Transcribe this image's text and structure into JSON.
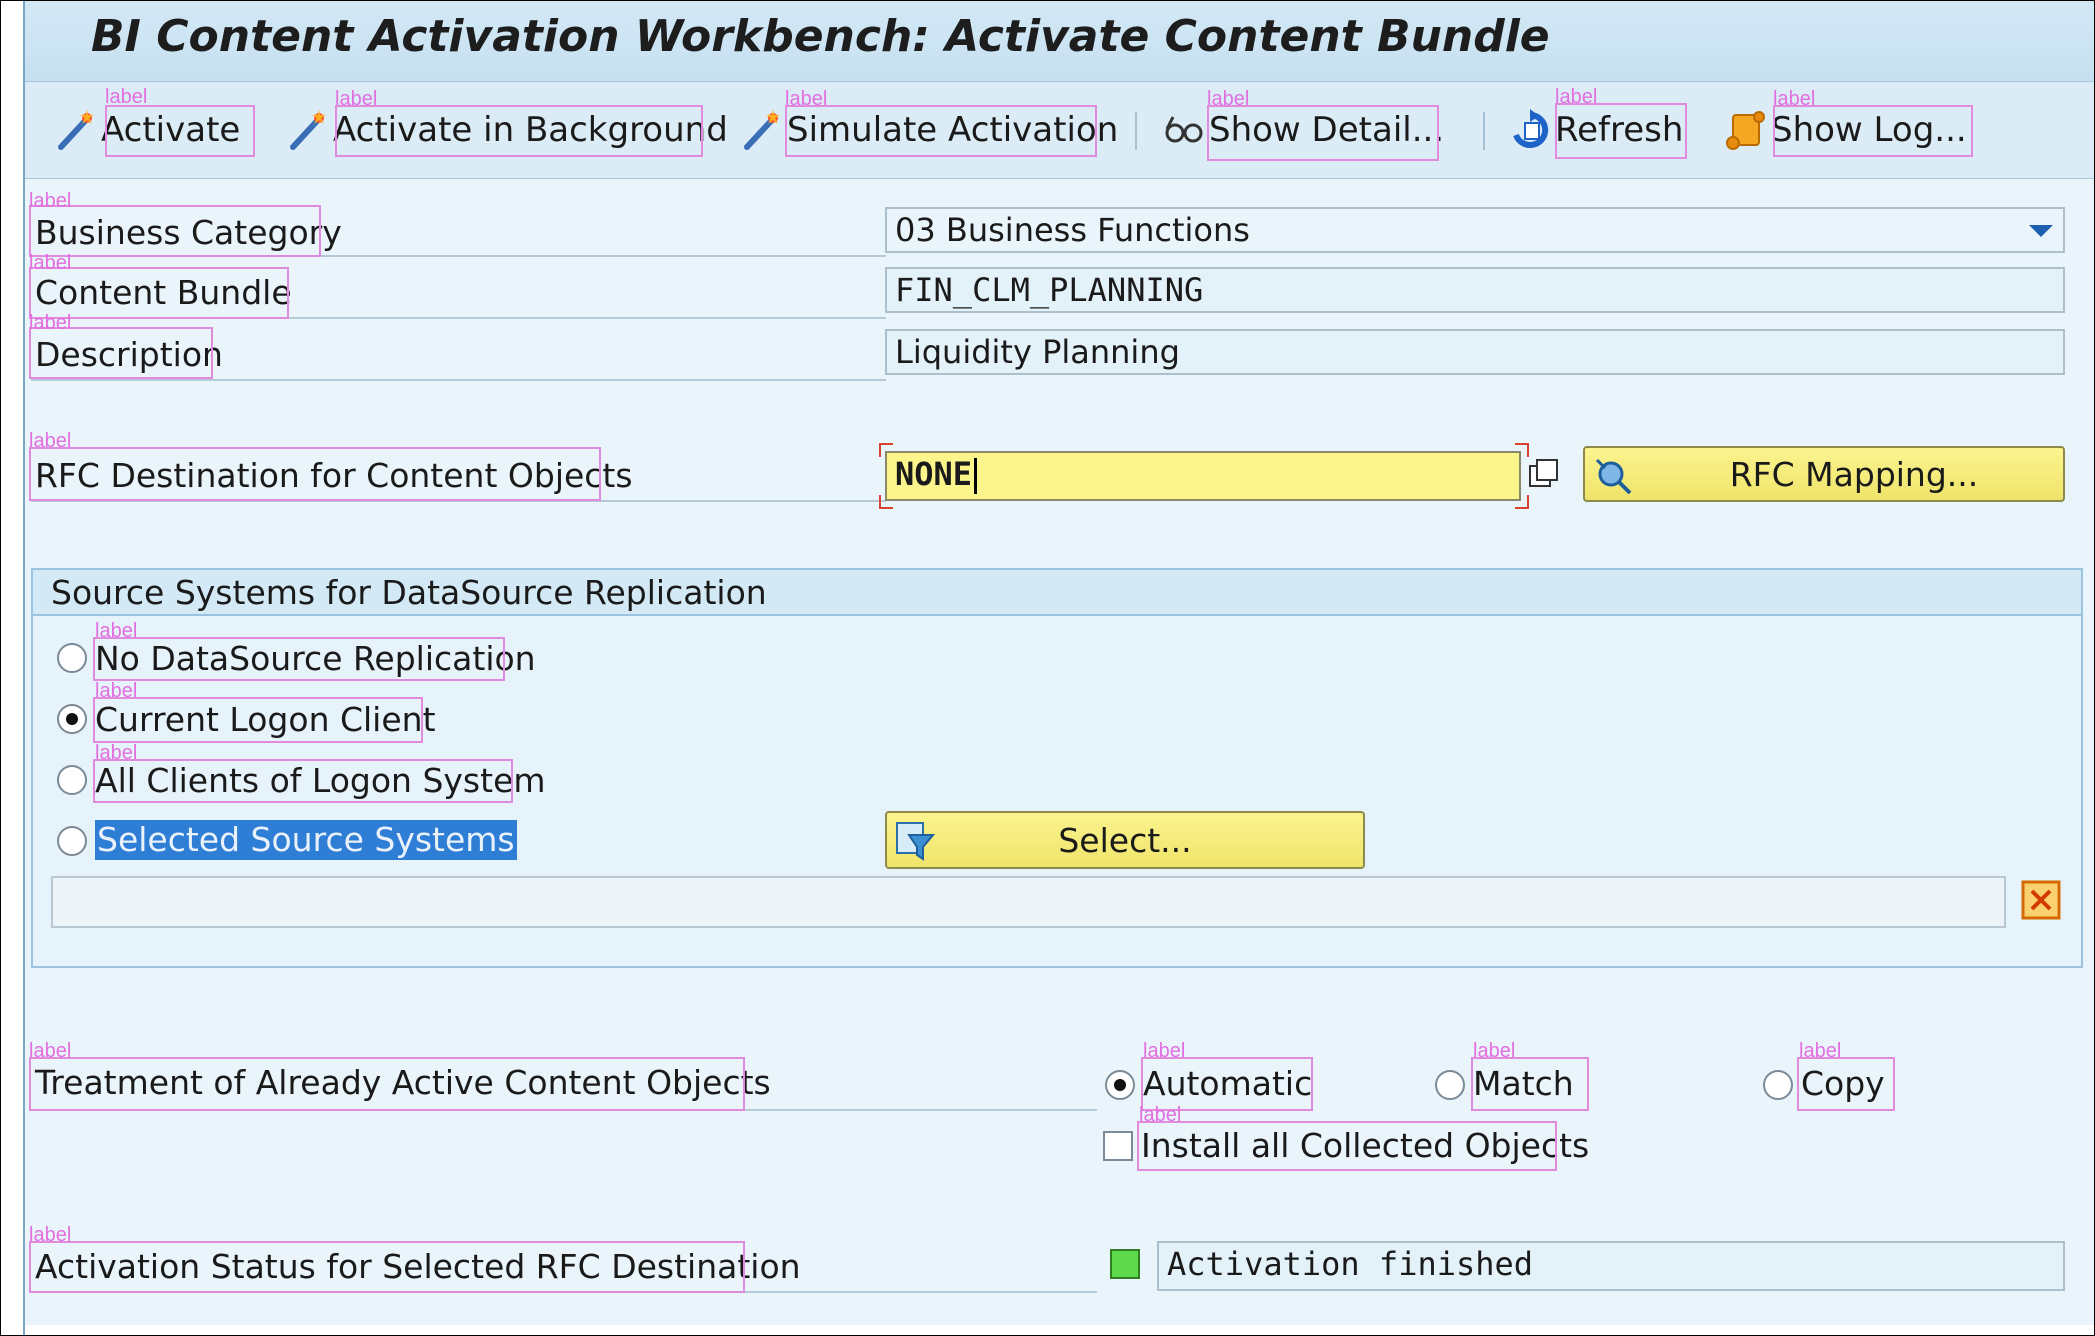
{
  "window": {
    "title": "BI Content Activation Workbench: Activate Content Bundle"
  },
  "toolbar": {
    "activate": "Activate",
    "activate_background": "Activate in Background",
    "simulate": "Simulate Activation",
    "show_detail": "Show Detail...",
    "refresh": "Refresh",
    "show_log": "Show Log..."
  },
  "form": {
    "business_category": {
      "label": "Business Category",
      "value": "03 Business Functions"
    },
    "content_bundle": {
      "label": "Content Bundle",
      "value": "FIN_CLM_PLANNING"
    },
    "description": {
      "label": "Description",
      "value": "Liquidity Planning"
    },
    "rfc_destination": {
      "label": "RFC Destination for Content Objects",
      "value": "NONE",
      "mapping_button": "RFC Mapping..."
    }
  },
  "source_systems": {
    "title": "Source Systems for DataSource Replication",
    "options": [
      {
        "label": "No DataSource Replication",
        "selected": false
      },
      {
        "label": "Current Logon Client",
        "selected": true
      },
      {
        "label": "All Clients of Logon System",
        "selected": false
      },
      {
        "label": "Selected Source Systems",
        "selected": false
      }
    ],
    "select_button": "Select...",
    "selected_systems_value": ""
  },
  "treatment": {
    "label": "Treatment of Already Active Content Objects",
    "options": [
      {
        "label": "Automatic",
        "selected": true
      },
      {
        "label": "Match",
        "selected": false
      },
      {
        "label": "Copy",
        "selected": false
      }
    ],
    "install_all": {
      "label": "Install all Collected Objects",
      "checked": false
    }
  },
  "status": {
    "label": "Activation Status for Selected RFC Destination",
    "value": "Activation finished",
    "light_color": "#5ed94b"
  },
  "annotations": {
    "tag": "label"
  },
  "colors": {
    "accent_blue": "#1b5fae",
    "required_yellow": "#fbf58b",
    "selection_blue": "#2f7ed6",
    "annotation_pink": "#e26ee0"
  }
}
